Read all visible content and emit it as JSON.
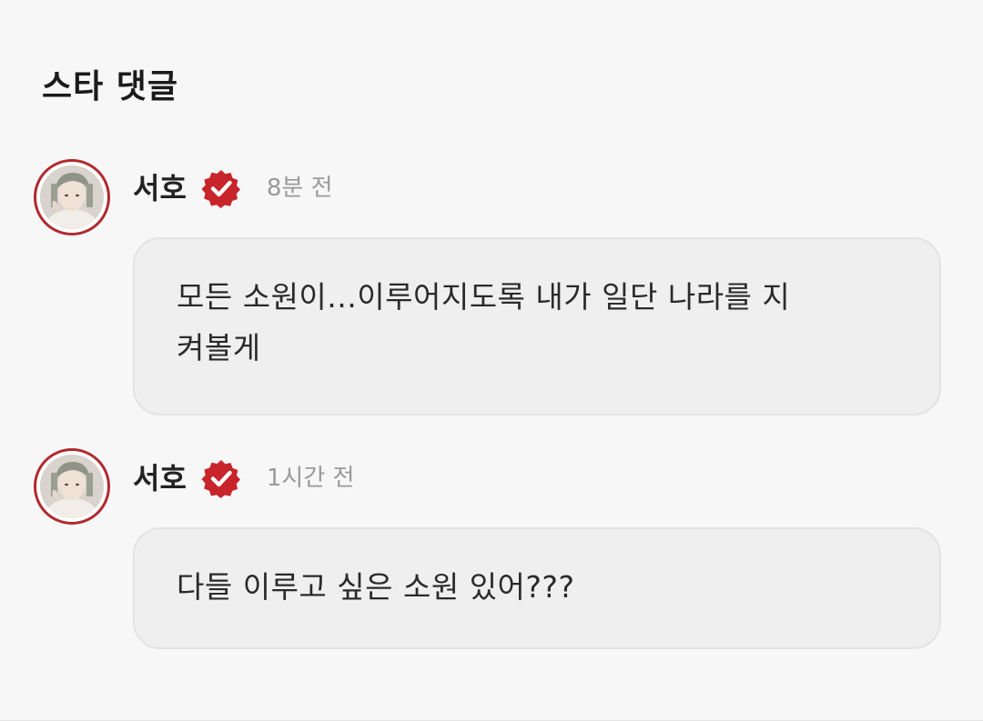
{
  "section": {
    "title": "스타 댓글"
  },
  "comments": [
    {
      "author": "서호",
      "time": "8분 전",
      "text": "모든 소원이...이루어지도록 내가 일단 나라를 지\n켜볼게",
      "avatar_icon": "profile-photo",
      "badge_icon": "verified-badge-icon",
      "badge_color": "#c8242b"
    },
    {
      "author": "서호",
      "time": "1시간 전",
      "text": "다들 이루고 싶은 소원 있어???",
      "avatar_icon": "profile-photo",
      "badge_icon": "verified-badge-icon",
      "badge_color": "#c8242b"
    }
  ],
  "colors": {
    "background": "#f7f7f7",
    "bubble": "#efefef",
    "avatar_ring": "#b02a2f",
    "time_text": "#9a9a9a"
  }
}
